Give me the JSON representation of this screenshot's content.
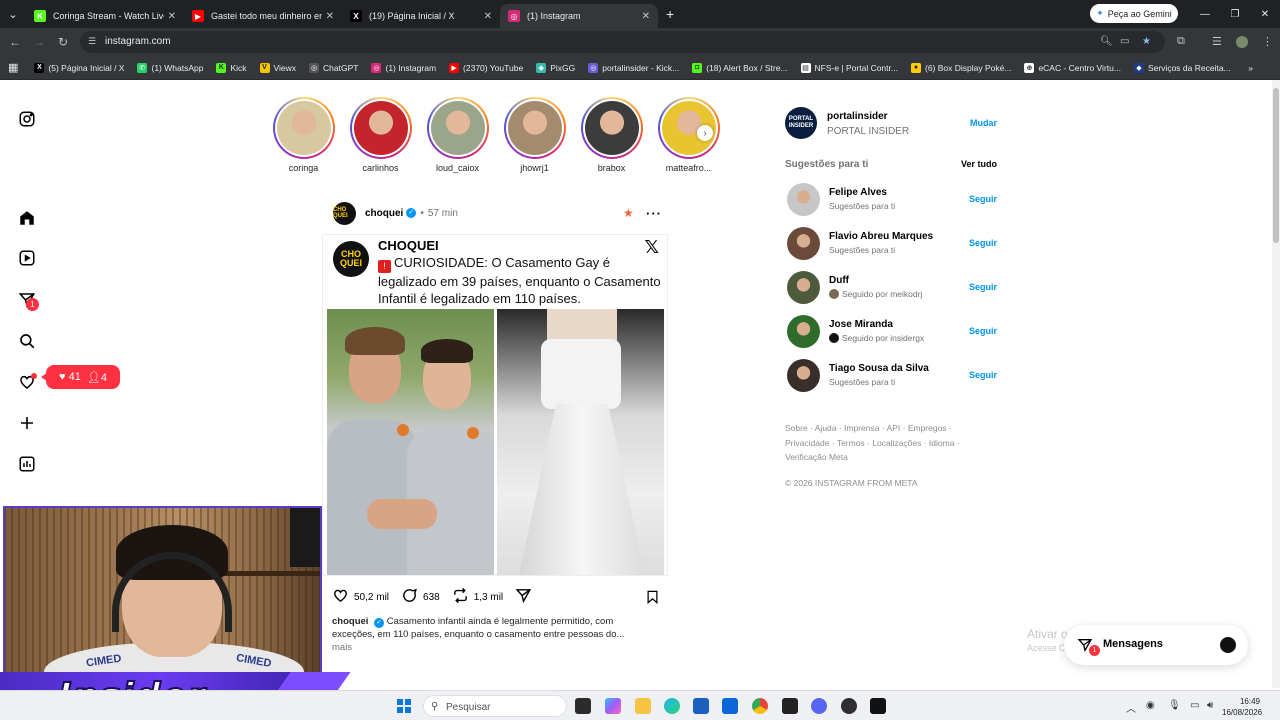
{
  "browser": {
    "tabs": [
      {
        "title": "Coringa Stream - Watch Live o",
        "color": "#53fc18",
        "glyph": "K",
        "active": false
      },
      {
        "title": "Gastei todo meu dinheiro em T",
        "color": "#ff0000",
        "glyph": "▶",
        "active": false
      },
      {
        "title": "(19) Página Inicial / X",
        "color": "#000000",
        "glyph": "X",
        "active": false
      },
      {
        "title": "(1) Instagram",
        "color": "#d62976",
        "glyph": "◎",
        "active": true
      }
    ],
    "new_tab": "+",
    "gemini_label": "Peça ao Gemini",
    "url": "instagram.com",
    "bookmarks": [
      {
        "label": "(5) Página Inicial / X",
        "color": "#000000",
        "glyph": "X"
      },
      {
        "label": "(1) WhatsApp",
        "color": "#25d366",
        "glyph": "✆"
      },
      {
        "label": "Kick",
        "color": "#53fc18",
        "glyph": "K"
      },
      {
        "label": "Viewx",
        "color": "#f5c400",
        "glyph": "V"
      },
      {
        "label": "ChatGPT",
        "color": "#555555",
        "glyph": "◎"
      },
      {
        "label": "(1) Instagram",
        "color": "#d62976",
        "glyph": "◎"
      },
      {
        "label": "(2370) YouTube",
        "color": "#ff0000",
        "glyph": "▶"
      },
      {
        "label": "PixGG",
        "color": "#32bcad",
        "glyph": "◆"
      },
      {
        "label": "portalinsider - Kick...",
        "color": "#6b5bd5",
        "glyph": "◎"
      },
      {
        "label": "(18) Alert Box / Stre...",
        "color": "#53fc18",
        "glyph": "◘"
      },
      {
        "label": "NFS-e | Portal Contr...",
        "color": "#ffffff",
        "glyph": "▤"
      },
      {
        "label": "(6) Box Display Poké...",
        "color": "#ffcb05",
        "glyph": "●"
      },
      {
        "label": "eCAC - Centro Virtu...",
        "color": "#ffffff",
        "glyph": "⊕"
      },
      {
        "label": "Serviços da Receita...",
        "color": "#1f3c88",
        "glyph": "◆"
      }
    ]
  },
  "instagram": {
    "notif_pill": {
      "likes": "41",
      "follows": "4"
    },
    "direct_badge": "1",
    "stories": [
      {
        "name": "coringa",
        "bg": "#d8c8a0"
      },
      {
        "name": "carlinhos",
        "bg": "#c4242c"
      },
      {
        "name": "loud_caiox",
        "bg": "#9aa58a"
      },
      {
        "name": "jhowrj1",
        "bg": "#a58b6e"
      },
      {
        "name": "brabox",
        "bg": "#3c3c3c"
      },
      {
        "name": "matteafro...",
        "bg": "#e8c431"
      }
    ],
    "post": {
      "user": "choquei",
      "time": "57 min",
      "avatar_text": "CHO QUEI",
      "tweet_name": "CHOQUEI",
      "tweet_text": "CURIOSIDADE: O Casamento Gay é legalizado em 39 países, enquanto o Casamento Infantil é legalizado em 110 países.",
      "likes": "50,2 mil",
      "comments": "638",
      "reposts": "1,3 mil",
      "caption_user": "choquei",
      "caption": "Casamento infantil ainda é legalmente permitido, com exceções, em 110 países, enquanto o casamento entre pessoas do...",
      "more": "mais"
    },
    "me": {
      "username": "portalinsider",
      "name": "PORTAL INSIDER",
      "switch": "Mudar",
      "avatar_text": "PORTAL INSIDER"
    },
    "suggestions_title": "Sugestões para ti",
    "see_all": "Ver tudo",
    "suggestions": [
      {
        "name": "Felipe Alves",
        "sub": "Sugestões para ti",
        "action": "Seguir",
        "bg": "#c7c7c7",
        "dot": ""
      },
      {
        "name": "Flavio Abreu Marques",
        "sub": "Sugestões para ti",
        "action": "Seguir",
        "bg": "#6b4a3a",
        "dot": ""
      },
      {
        "name": "Duff",
        "sub": "Seguido por meikodrj",
        "action": "Seguir",
        "bg": "#4d5a3c",
        "dot": "#7a6a55"
      },
      {
        "name": "Jose Miranda",
        "sub": "Seguido por insidergx",
        "action": "Seguir",
        "bg": "#2f6b2a",
        "dot": "#111111"
      },
      {
        "name": "Tiago Sousa da Silva",
        "sub": "Sugestões para ti",
        "action": "Seguir",
        "bg": "#3a2e2a",
        "dot": ""
      }
    ],
    "footer_links_1": "Sobre · Ajuda · Imprensa · API · Empregos ·",
    "footer_links_2": "Privacidade · Termos · Localizações · Idioma ·",
    "footer_links_3": "Verificação Meta",
    "copyright": "© 2026 INSTAGRAM FROM META",
    "messages_label": "Mensagens",
    "messages_badge": "1"
  },
  "windows_watermark": {
    "title": "Ativar o Windows",
    "sub": "Acesse Configurações para ativar o Windows."
  },
  "overlay": {
    "banner_text": "Insider",
    "shirt_text": "CIMED"
  },
  "taskbar": {
    "search_placeholder": "Pesquisar",
    "time": "16:49",
    "date": "16/08/2026"
  }
}
